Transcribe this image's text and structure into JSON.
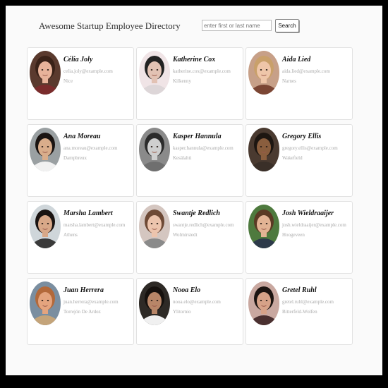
{
  "header": {
    "title": "Awesome Startup Employee Directory",
    "search_placeholder": "enter first or last name",
    "search_button_label": "Search"
  },
  "employees": [
    {
      "name": "Célia Joly",
      "email": "celia.joly@example.com",
      "city": "Nice",
      "avatar_bg": "#5a3a2e",
      "skin": "#e8b39a",
      "hair": "#3a2218",
      "shirt": "#7a2c2c"
    },
    {
      "name": "Katherine Cox",
      "email": "katherine.cox@example.com",
      "city": "Kilkenny",
      "avatar_bg": "#f0e4e6",
      "skin": "#e2c2b4",
      "hair": "#222222",
      "shirt": "#ddd6d8"
    },
    {
      "name": "Aida Lied",
      "email": "aida.lied@example.com",
      "city": "Narnes",
      "avatar_bg": "#c7a088",
      "skin": "#efc6a9",
      "hair": "#c9a06a",
      "shirt": "#7b4634"
    },
    {
      "name": "Ana Moreau",
      "email": "ana.moreau@example.com",
      "city": "Dampbreux",
      "avatar_bg": "#9aa0a2",
      "skin": "#d9ad8b",
      "hair": "#1a1412",
      "shirt": "#f1f1f1"
    },
    {
      "name": "Kasper Hannula",
      "email": "kasper.hannula@example.com",
      "city": "Kesälahti",
      "avatar_bg": "#8a8a8a",
      "skin": "#cfcfcf",
      "hair": "#2b2b2b",
      "shirt": "#6f6f6f"
    },
    {
      "name": "Gregory Ellis",
      "email": "gregory.ellis@example.com",
      "city": "Wakefield",
      "avatar_bg": "#4a3a30",
      "skin": "#8a5e3e",
      "hair": "#1d1611",
      "shirt": "#3a2f28"
    },
    {
      "name": "Marsha Lambert",
      "email": "marsha.lambert@example.com",
      "city": "Athens",
      "avatar_bg": "#cfd6da",
      "skin": "#d8a888",
      "hair": "#1a1412",
      "shirt": "#3a3a3a"
    },
    {
      "name": "Swantje Redlich",
      "email": "swantje.redlich@example.com",
      "city": "Wolmirstedt",
      "avatar_bg": "#d4c6c0",
      "skin": "#ecc4ad",
      "hair": "#6e4a36",
      "shirt": "#8a8a8a"
    },
    {
      "name": "Josh Wieldraaijer",
      "email": "josh.wieldraaijer@example.com",
      "city": "Hoogeveen",
      "avatar_bg": "#4e7a3e",
      "skin": "#e2b394",
      "hair": "#5a3a24",
      "shirt": "#2d3a4a"
    },
    {
      "name": "Juan Herrera",
      "email": "juan.herrera@example.com",
      "city": "Torrejón De Ardoz",
      "avatar_bg": "#7a8ea0",
      "skin": "#e4a47e",
      "hair": "#b3693a",
      "shirt": "#c4a47a"
    },
    {
      "name": "Nooa Elo",
      "email": "nooa.elo@example.com",
      "city": "Ylitornio",
      "avatar_bg": "#2e2a26",
      "skin": "#b88668",
      "hair": "#16110e",
      "shirt": "#f0f0f0"
    },
    {
      "name": "Gretel Ruhl",
      "email": "gretel.ruhl@example.com",
      "city": "Bitterfeld-Wolfen",
      "avatar_bg": "#c9a8a0",
      "skin": "#d6a288",
      "hair": "#1c1411",
      "shirt": "#4a3030"
    }
  ]
}
